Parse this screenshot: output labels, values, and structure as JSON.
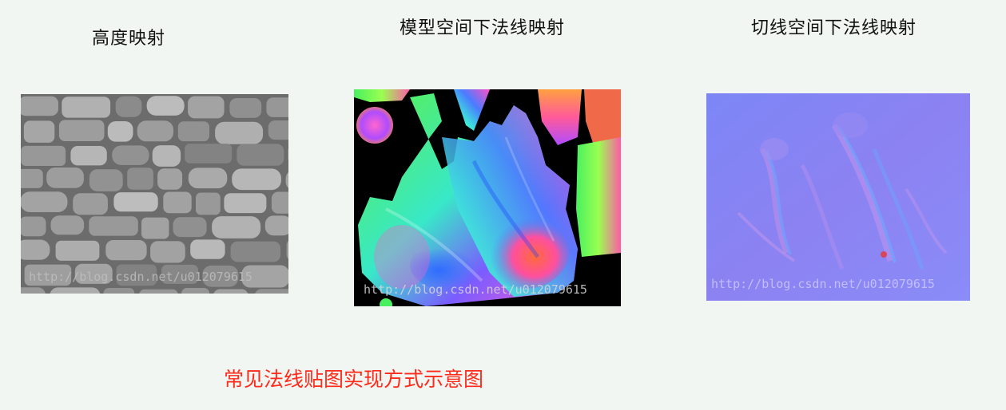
{
  "labels": {
    "height_map": "高度映射",
    "model_space": "模型空间下法线映射",
    "tangent_space": "切线空间下法线映射"
  },
  "watermark": "http://blog.csdn.net/u012079615",
  "caption": "常见法线贴图实现方式示意图",
  "colors": {
    "background": "#f1f6f3",
    "caption": "#ff2a1a",
    "tangent_base": "#8a86f4"
  }
}
